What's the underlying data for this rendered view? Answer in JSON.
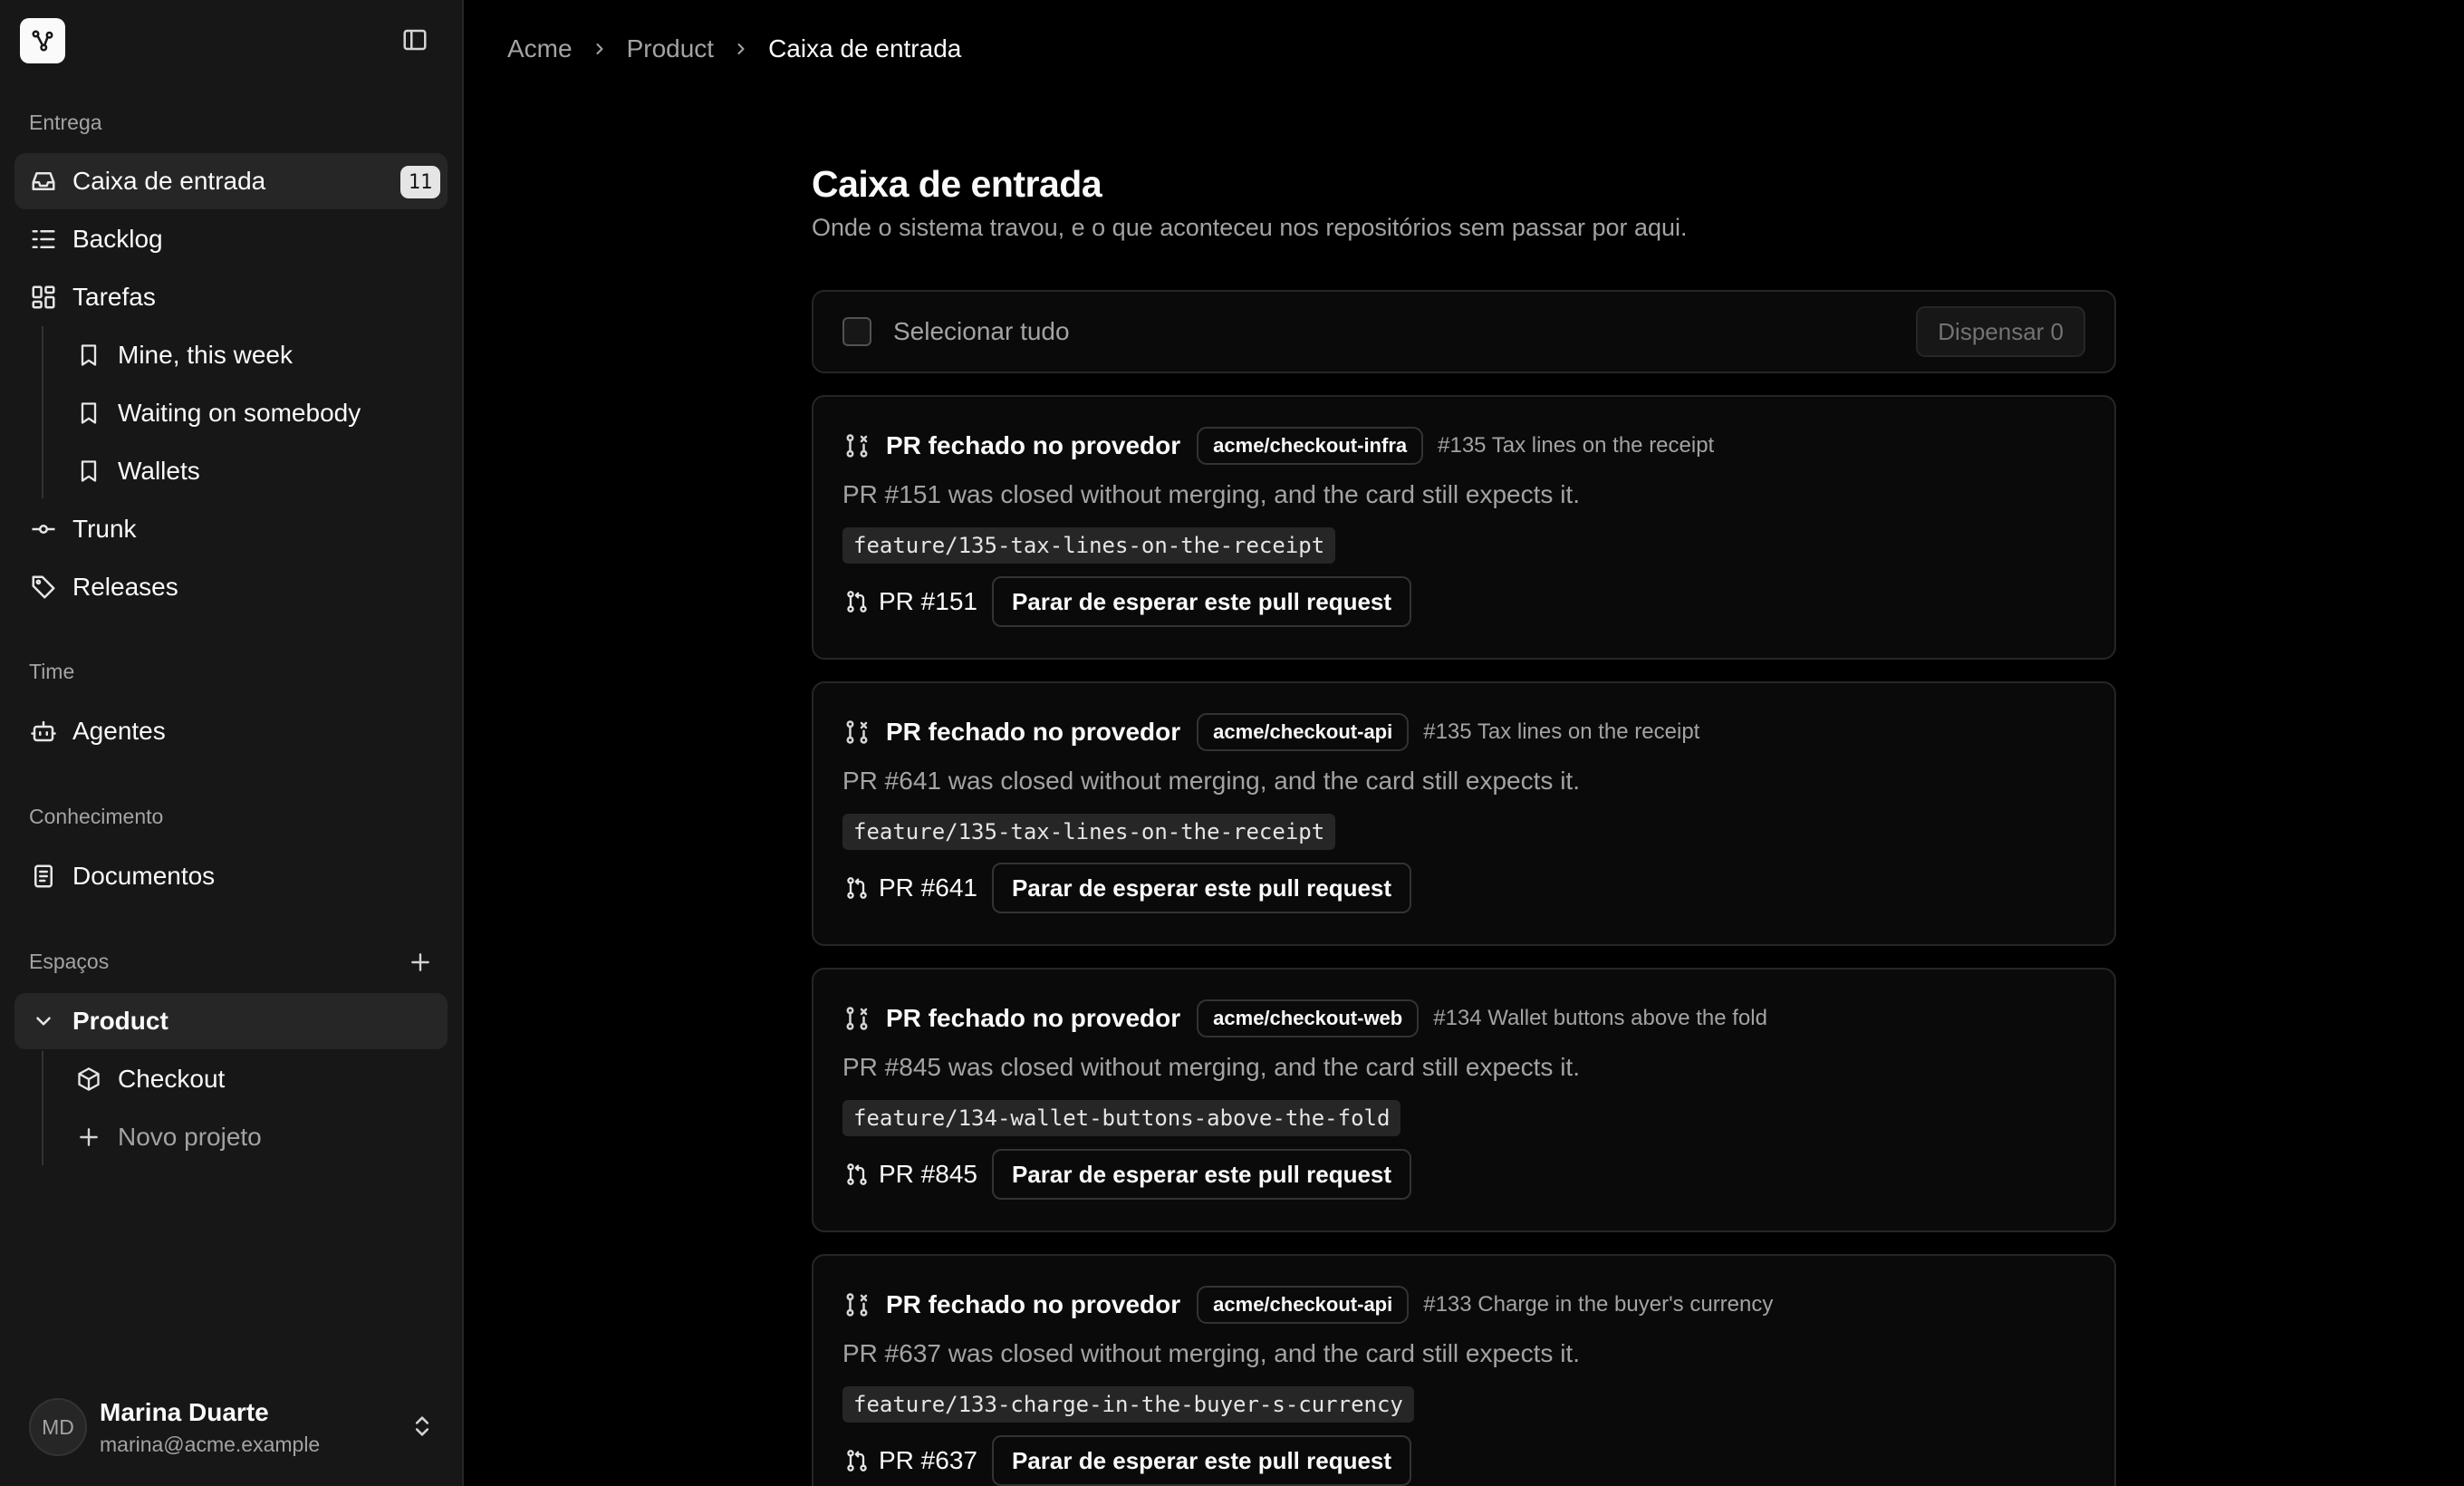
{
  "sidebar": {
    "logo_icon": "share-nodes-icon",
    "collapse_icon": "sidebar-toggle-icon",
    "sections": {
      "delivery": "Entrega",
      "team": "Time",
      "knowledge": "Conhecimento",
      "spaces": "Espaços"
    },
    "nav": {
      "inbox": {
        "label": "Caixa de entrada",
        "badge": "11",
        "icon": "inbox-icon"
      },
      "backlog": {
        "label": "Backlog",
        "icon": "list-checks-icon"
      },
      "tasks": {
        "label": "Tarefas",
        "icon": "layout-grid-icon"
      },
      "views": [
        {
          "label": "Mine, this week",
          "icon": "bookmark-icon"
        },
        {
          "label": "Waiting on somebody",
          "icon": "bookmark-icon"
        },
        {
          "label": "Wallets",
          "icon": "bookmark-icon"
        }
      ],
      "trunk": {
        "label": "Trunk",
        "icon": "commit-icon"
      },
      "releases": {
        "label": "Releases",
        "icon": "tag-icon"
      },
      "agents": {
        "label": "Agentes",
        "icon": "bot-icon"
      },
      "docs": {
        "label": "Documentos",
        "icon": "document-icon"
      },
      "space": {
        "label": "Product",
        "icon": "chevron-down-icon"
      },
      "projects": [
        {
          "label": "Checkout",
          "icon": "box-icon"
        }
      ],
      "new_project": {
        "label": "Novo projeto",
        "icon": "plus-icon"
      }
    },
    "user": {
      "initials": "MD",
      "name": "Marina Duarte",
      "email": "marina@acme.example"
    }
  },
  "breadcrumb": [
    "Acme",
    "Product",
    "Caixa de entrada"
  ],
  "page": {
    "title": "Caixa de entrada",
    "subtitle": "Onde o sistema travou, e o que aconteceu nos repositórios sem passar por aqui."
  },
  "selection": {
    "select_all": "Selecionar tudo",
    "dismiss": "Dispensar 0"
  },
  "cards": [
    {
      "title": "PR fechado no provedor",
      "repo": "acme/checkout-infra",
      "ref": "#135 Tax lines on the receipt",
      "desc": "PR #151 was closed without merging, and the card still expects it.",
      "branch": "feature/135-tax-lines-on-the-receipt",
      "pr": "PR #151",
      "action": "Parar de esperar este pull request"
    },
    {
      "title": "PR fechado no provedor",
      "repo": "acme/checkout-api",
      "ref": "#135 Tax lines on the receipt",
      "desc": "PR #641 was closed without merging, and the card still expects it.",
      "branch": "feature/135-tax-lines-on-the-receipt",
      "pr": "PR #641",
      "action": "Parar de esperar este pull request"
    },
    {
      "title": "PR fechado no provedor",
      "repo": "acme/checkout-web",
      "ref": "#134 Wallet buttons above the fold",
      "desc": "PR #845 was closed without merging, and the card still expects it.",
      "branch": "feature/134-wallet-buttons-above-the-fold",
      "pr": "PR #845",
      "action": "Parar de esperar este pull request"
    },
    {
      "title": "PR fechado no provedor",
      "repo": "acme/checkout-api",
      "ref": "#133 Charge in the buyer's currency",
      "desc": "PR #637 was closed without merging, and the card still expects it.",
      "branch": "feature/133-charge-in-the-buyer-s-currency",
      "pr": "PR #637",
      "action": "Parar de esperar este pull request"
    }
  ]
}
